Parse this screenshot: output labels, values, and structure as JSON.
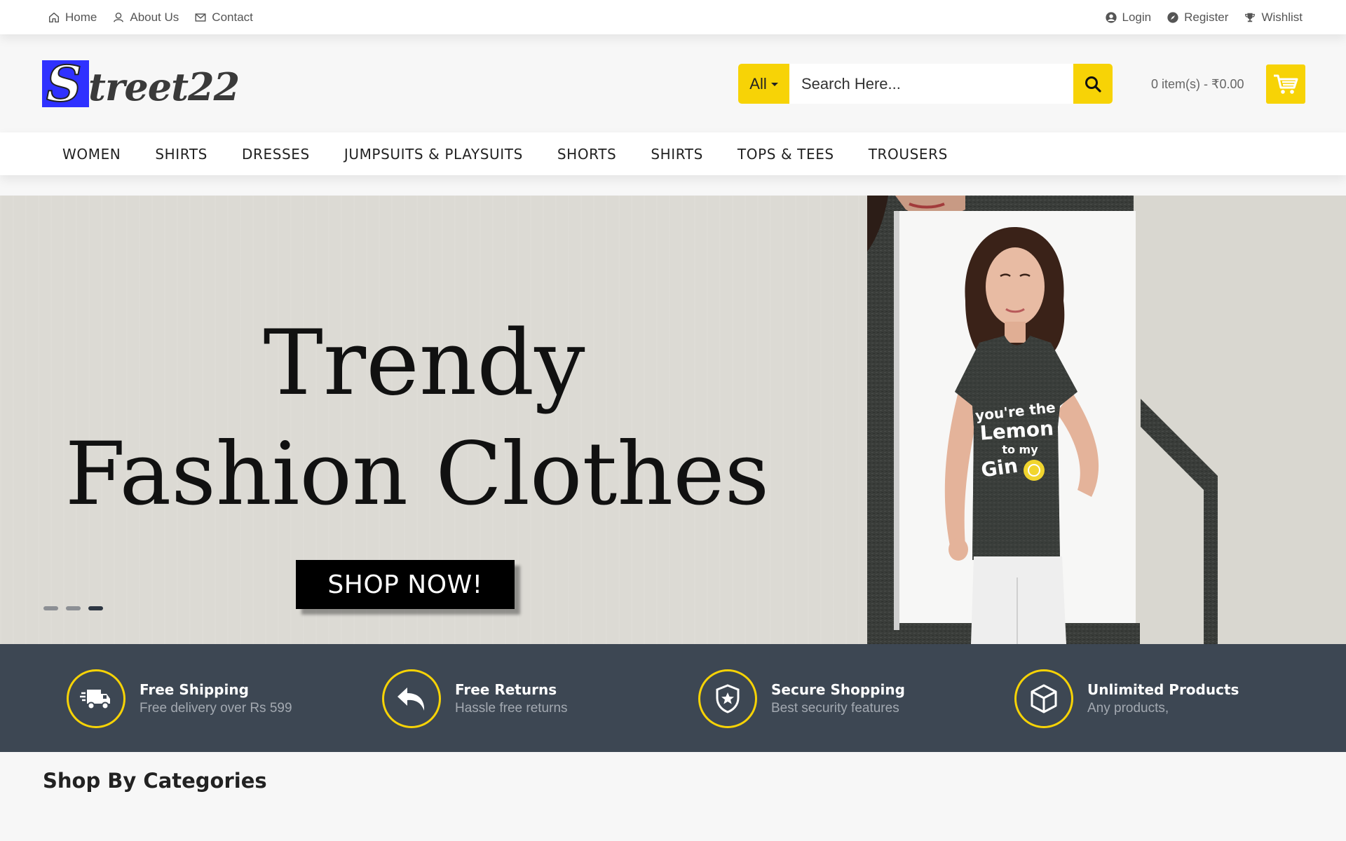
{
  "topbar": {
    "left_links": [
      {
        "label": "Home",
        "icon": "home-icon"
      },
      {
        "label": "About Us",
        "icon": "user-icon"
      },
      {
        "label": "Contact",
        "icon": "mail-icon"
      }
    ],
    "right_links": [
      {
        "label": "Login",
        "icon": "user-circle-icon"
      },
      {
        "label": "Register",
        "icon": "compass-icon"
      },
      {
        "label": "Wishlist",
        "icon": "trophy-icon"
      }
    ]
  },
  "logo": {
    "initial": "S",
    "rest": "treet22",
    "color": "#2f31ff"
  },
  "search": {
    "category": "All",
    "placeholder": "Search Here..."
  },
  "cart": {
    "summary": "0 item(s) - ₹0.00"
  },
  "categories": [
    "WOMEN",
    "SHIRTS",
    "DRESSES",
    "JUMPSUITS & PLAYSUITS",
    "SHORTS",
    "SHIRTS",
    "TOPS & TEES",
    "TROUSERS"
  ],
  "hero": {
    "line1": "Trendy",
    "line2": "Fashion Clothes",
    "cta": "SHOP NOW!",
    "shirt_text": [
      "you're the",
      "Lemon",
      "to my",
      "Gin"
    ],
    "slides": 3,
    "active_slide": 3
  },
  "features": [
    {
      "title": "Free Shipping",
      "subtitle": "Free delivery over Rs 599",
      "icon": "truck-icon"
    },
    {
      "title": "Free Returns",
      "subtitle": "Hassle free returns",
      "icon": "return-arrow-icon"
    },
    {
      "title": "Secure Shopping",
      "subtitle": "Best security features",
      "icon": "shield-icon"
    },
    {
      "title": "Unlimited Products",
      "subtitle": "Any products,",
      "icon": "box-icon"
    }
  ],
  "section": {
    "title": "Shop By Categories"
  },
  "colors": {
    "accent": "#f7d306",
    "band": "#3d4753",
    "logo_blue": "#2f31ff"
  }
}
